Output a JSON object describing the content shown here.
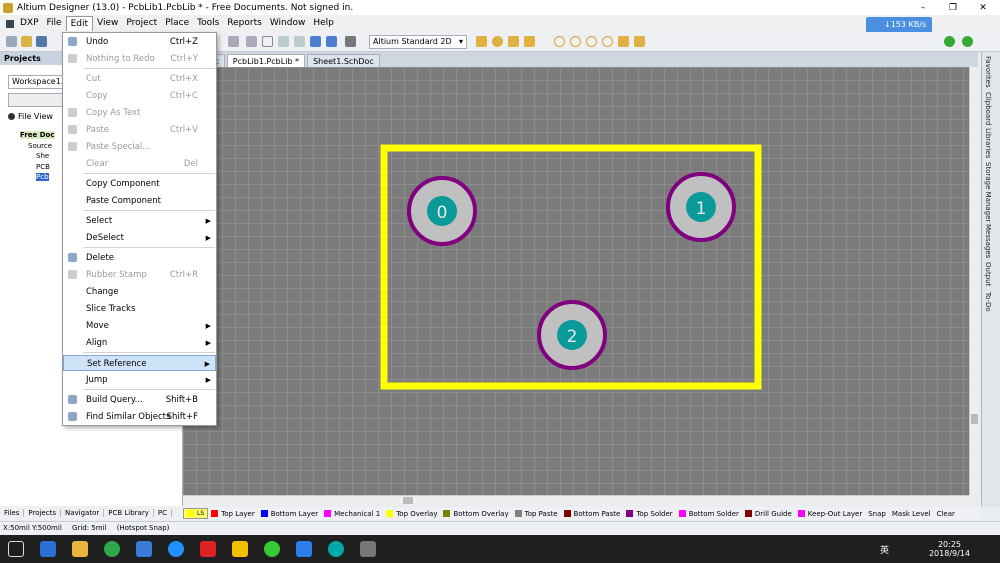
{
  "window": {
    "title": "Altium Designer (13.0) - PcbLib1.PcbLib * - Free Documents. Not signed in.",
    "min": "–",
    "max": "❐",
    "close": "✕"
  },
  "menubar": {
    "items": [
      "DXP",
      "File",
      "Edit",
      "View",
      "Project",
      "Place",
      "Tools",
      "Reports",
      "Window",
      "Help"
    ]
  },
  "toolbar": {
    "view_mode": "Altium Standard 2D"
  },
  "net": {
    "speed": "↓153 KB/s"
  },
  "project_panel": {
    "title": "Projects",
    "workspace": "Workspace1.Ds",
    "radio": "File View",
    "tree": [
      "Free Doc",
      "Source",
      "She",
      "PCB",
      "Pcb"
    ]
  },
  "doc_tabs": [
    "PcbDoc",
    "PcbLib1.PcbLib *",
    "Sheet1.SchDoc"
  ],
  "edit_menu": {
    "items": [
      {
        "label": "Undo",
        "shortcut": "Ctrl+Z",
        "enabled": true
      },
      {
        "label": "Nothing to Redo",
        "shortcut": "Ctrl+Y",
        "enabled": false
      },
      {
        "label": "Cut",
        "shortcut": "Ctrl+X",
        "enabled": false
      },
      {
        "label": "Copy",
        "shortcut": "Ctrl+C",
        "enabled": false
      },
      {
        "label": "Copy As Text",
        "shortcut": "",
        "enabled": false
      },
      {
        "label": "Paste",
        "shortcut": "Ctrl+V",
        "enabled": false
      },
      {
        "label": "Paste Special...",
        "shortcut": "",
        "enabled": false
      },
      {
        "label": "Clear",
        "shortcut": "Del",
        "enabled": false
      },
      {
        "label": "Copy Component",
        "shortcut": "",
        "enabled": true
      },
      {
        "label": "Paste Component",
        "shortcut": "",
        "enabled": true
      },
      {
        "label": "Select",
        "shortcut": "",
        "enabled": true,
        "submenu": true
      },
      {
        "label": "DeSelect",
        "shortcut": "",
        "enabled": true,
        "submenu": true
      },
      {
        "label": "Delete",
        "shortcut": "",
        "enabled": true
      },
      {
        "label": "Rubber Stamp",
        "shortcut": "Ctrl+R",
        "enabled": false
      },
      {
        "label": "Change",
        "shortcut": "",
        "enabled": true
      },
      {
        "label": "Slice Tracks",
        "shortcut": "",
        "enabled": true
      },
      {
        "label": "Move",
        "shortcut": "",
        "enabled": true,
        "submenu": true
      },
      {
        "label": "Align",
        "shortcut": "",
        "enabled": true,
        "submenu": true
      },
      {
        "label": "Set Reference",
        "shortcut": "",
        "enabled": true,
        "submenu": true,
        "highlighted": true
      },
      {
        "label": "Jump",
        "shortcut": "",
        "enabled": true,
        "submenu": true
      },
      {
        "label": "Build Query...",
        "shortcut": "Shift+B",
        "enabled": true
      },
      {
        "label": "Find Similar Objects",
        "shortcut": "Shift+F",
        "enabled": true
      }
    ]
  },
  "pads": [
    {
      "label": "0"
    },
    {
      "label": "1"
    },
    {
      "label": "2"
    }
  ],
  "colors": {
    "outline": "#ffff00",
    "pad_ring": "#800080",
    "pad_body": "#c0c0c0",
    "pad_hole": "#0a9a9a",
    "canvas": "#7b7b7b"
  },
  "panel_tabs": [
    "Files",
    "Projects",
    "Navigator",
    "PCB Library",
    "PC"
  ],
  "layers": [
    {
      "name": "LS",
      "color": "#ffff00",
      "active": true
    },
    {
      "name": "Top Layer",
      "color": "#ff0000"
    },
    {
      "name": "Bottom Layer",
      "color": "#0000ff"
    },
    {
      "name": "Mechanical 1",
      "color": "#ff00ff"
    },
    {
      "name": "Top Overlay",
      "color": "#ffff00"
    },
    {
      "name": "Bottom Overlay",
      "color": "#808000"
    },
    {
      "name": "Top Paste",
      "color": "#808080"
    },
    {
      "name": "Bottom Paste",
      "color": "#800000"
    },
    {
      "name": "Top Solder",
      "color": "#800080"
    },
    {
      "name": "Bottom Solder",
      "color": "#ff00ff"
    },
    {
      "name": "Drill Guide",
      "color": "#800000"
    },
    {
      "name": "Keep-Out Layer",
      "color": "#ff00ff"
    },
    {
      "name": "Snap",
      "color": ""
    },
    {
      "name": "Mask Level",
      "color": ""
    },
    {
      "name": "Clear",
      "color": ""
    }
  ],
  "right_tabs": [
    "Favorites",
    "Clipboard",
    "Libraries",
    "Storage Manager",
    "Messages",
    "Output",
    "To-Do"
  ],
  "status": {
    "coords": "X:50mil Y:500mil",
    "grid": "Grid: 5mil",
    "snap": "(Hotspot Snap)"
  },
  "clock": {
    "time": "20:25",
    "date": "2018/9/14",
    "ime": "英"
  }
}
